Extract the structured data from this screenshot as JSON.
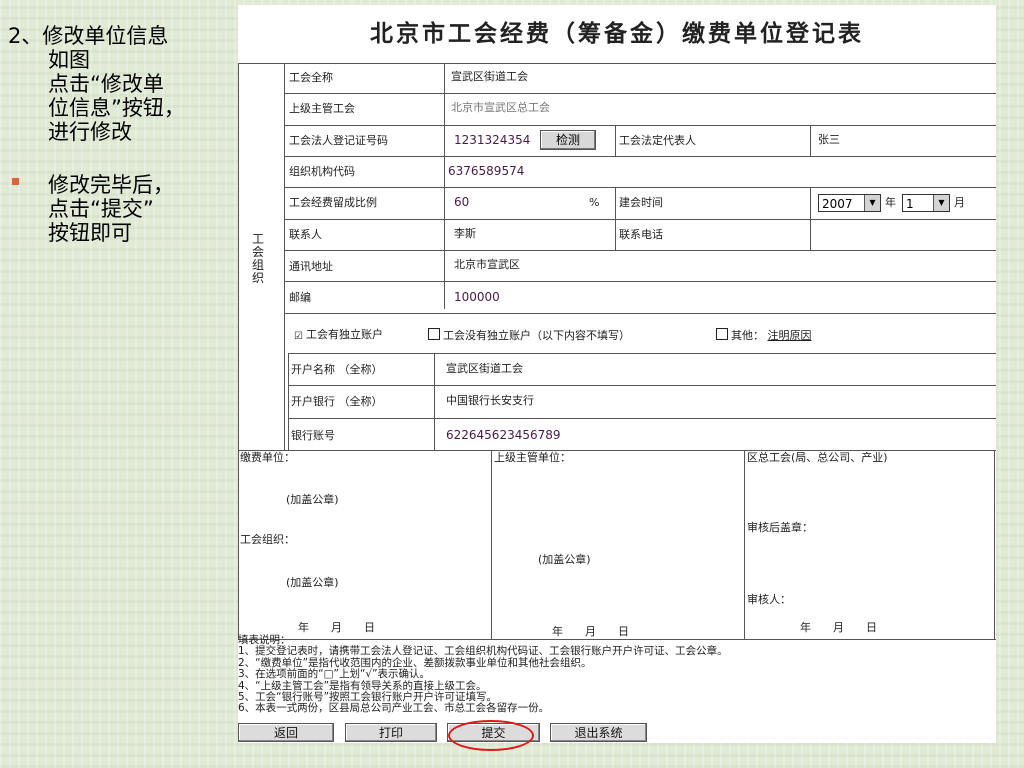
{
  "sidebar": {
    "step": {
      "line1": "2、修改单位信息",
      "line2": "如图",
      "line3": "点击“修改单",
      "line4": "位信息”按钮，",
      "line5": "进行修改"
    },
    "bullet": {
      "line1": "修改完毕后，",
      "line2": "点击“提交”",
      "line3": "按钮即可"
    },
    "bullet_color": "#d9663a"
  },
  "form": {
    "title": "北京市工会经费（筹备金）缴费单位登记表",
    "section_label": "工会组织",
    "rows": {
      "full_name_label": "工会全称",
      "full_name_value": "宣武区街道工会",
      "superior_label": "上级主管工会",
      "superior_value": "北京市宣武区总工会",
      "reg_no_label": "工会法人登记证号码",
      "reg_no_value": "1231324354",
      "detect_button": "检测",
      "legal_rep_label": "工会法定代表人",
      "legal_rep_value": "张三",
      "org_code_label": "组织机构代码",
      "org_code_value": "6376589574",
      "ratio_label": "工会经费留成比例",
      "ratio_value": "60",
      "ratio_unit": "%",
      "founded_label": "建会时间",
      "year_value": "2007",
      "year_unit": "年",
      "month_value": "1",
      "month_unit": "月",
      "contact_label": "联系人",
      "contact_value": "李斯",
      "phone_label": "联系电话",
      "phone_value": "",
      "address_label": "通讯地址",
      "address_value": "北京市宣武区",
      "zip_label": "邮编",
      "zip_value": "100000",
      "account_opt1": "工会有独立账户",
      "account_opt1_checked": "☑",
      "account_opt2": "工会没有独立账户（以下内容不填写）",
      "account_opt3": "其他：",
      "account_opt3_link": "注明原因",
      "acct_name_label": "开户名称 （全称）",
      "acct_name_value": "宣武区街道工会",
      "bank_label": "开户银行 （全称）",
      "bank_value": "中国银行长安支行",
      "acct_no_label": "银行账号",
      "acct_no_value": "622645623456789"
    },
    "signature": {
      "payer_label": "缴费单位：",
      "payer_seal": "(加盖公章)",
      "union_label": "工会组织：",
      "union_seal": "(加盖公章)",
      "date_left": "年　　月　　日",
      "superior_label": "上级主管单位：",
      "superior_seal": "(加盖公章)",
      "date_mid": "年　　月　　日",
      "district_label": "区总工会(局、总公司、产业)",
      "review_seal_label": "审核后盖章：",
      "reviewer_label": "审核人：",
      "date_right": "年　　月　　日"
    },
    "notes": {
      "title": "填表说明：",
      "n1": "1、提交登记表时，请携带工会法人登记证、工会组织机构代码证、工会银行账户开户许可证、工会公章。",
      "n2": "2、“缴费单位”是指代收范围内的企业、差额拨款事业单位和其他社会组织。",
      "n3": "3、在选项前面的“□”上划“√”表示确认。",
      "n4": "4、“上级主管工会”是指有领导关系的直接上级工会。",
      "n5": "5、工会“银行账号”按照工会银行账户开户许可证填写。",
      "n6": "6、本表一式两份，区县局总公司产业工会、市总工会各留存一份。"
    },
    "buttons": {
      "back": "返回",
      "print": "打印",
      "submit": "提交",
      "exit": "退出系统"
    },
    "highlight_color": "#e01818"
  }
}
